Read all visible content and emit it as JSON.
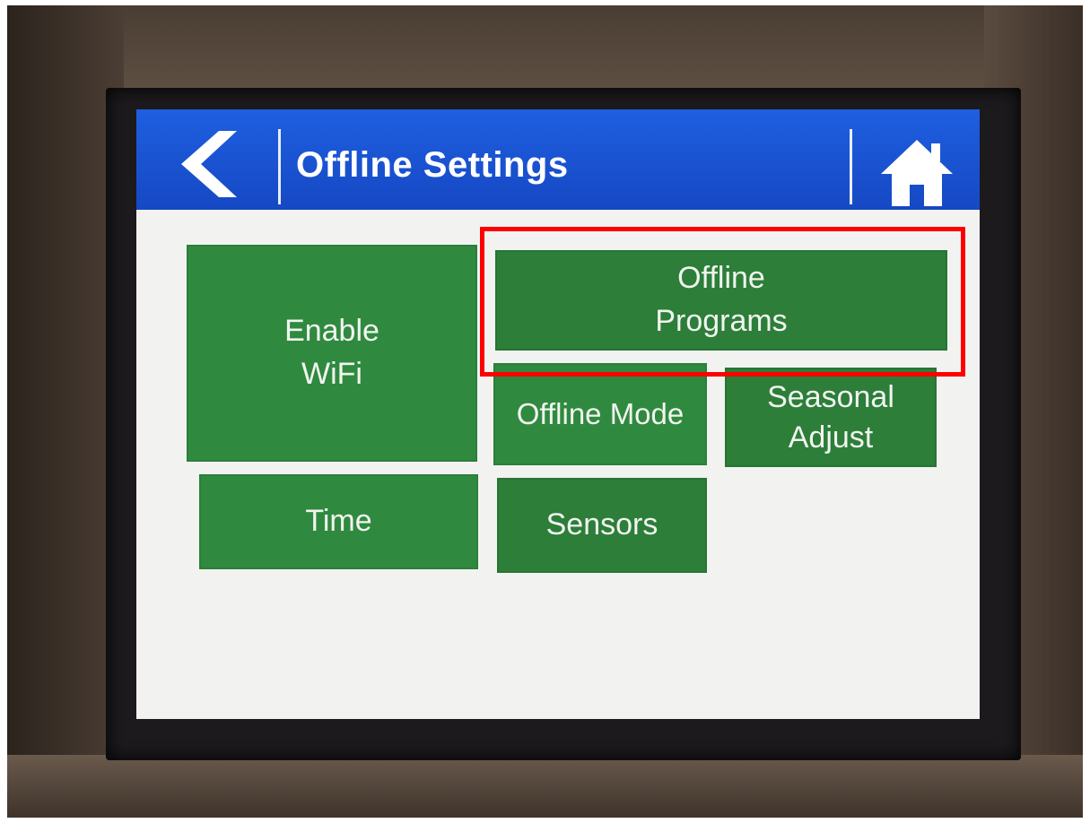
{
  "header": {
    "title": "Offline Settings",
    "back_icon": "chevron-left-icon",
    "home_icon": "home-icon",
    "bar_color": "#1a52d6"
  },
  "tiles": {
    "enable_wifi": {
      "line1": "Enable",
      "line2": "WiFi"
    },
    "offline_programs": {
      "line1": "Offline",
      "line2": "Programs"
    },
    "offline_mode": {
      "label": "Offline Mode"
    },
    "seasonal_adjust": {
      "line1": "Seasonal",
      "line2": "Adjust"
    },
    "time": {
      "label": "Time"
    },
    "sensors": {
      "label": "Sensors"
    }
  },
  "colors": {
    "tile": "#2f8a3f",
    "highlight": "#ff0000",
    "screen_bg": "#f2f3f1"
  }
}
